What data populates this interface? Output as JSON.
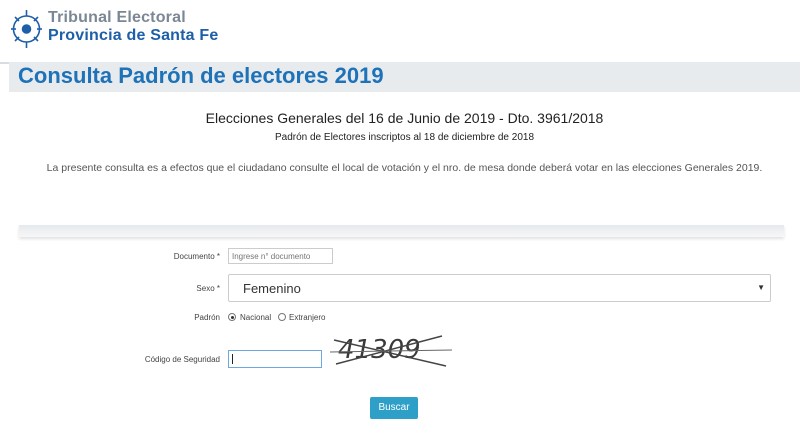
{
  "header": {
    "org_line1": "Tribunal Electoral",
    "org_line2": "Provincia de Santa Fe",
    "logo_icon": "seal-icon"
  },
  "page": {
    "title": "Consulta Padrón de electores 2019"
  },
  "info": {
    "heading": "Elecciones Generales del 16 de Junio de 2019 - Dto. 3961/2018",
    "subheading": "Padrón de Electores inscriptos al 18 de diciembre de 2018",
    "description": "La presente consulta es a efectos que el ciudadano consulte el local de votación y el nro. de mesa donde deberá votar en las elecciones Generales 2019."
  },
  "form": {
    "documento_label": "Documento *",
    "documento_placeholder": "Ingrese n° documento",
    "sexo_label": "Sexo *",
    "sexo_value": "Femenino",
    "padron_label": "Padrón",
    "padron_options": [
      "Nacional",
      "Extranjero"
    ],
    "padron_selected": "Nacional",
    "codigo_label": "Código de Seguridad",
    "codigo_value": "",
    "captcha_text": "41309",
    "submit_label": "Buscar"
  },
  "colors": {
    "brand_blue": "#1d72b8",
    "button": "#2e9fc7"
  }
}
